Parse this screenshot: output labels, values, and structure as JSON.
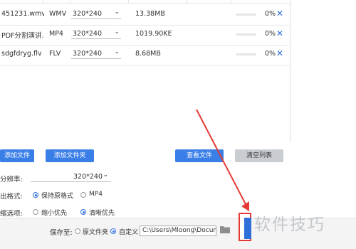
{
  "files": [
    {
      "name": "451231.wmv",
      "format": "WMV",
      "resolution": "320*240",
      "size": "13.38MB",
      "progress_pct": "0%"
    },
    {
      "name": "PDF分割演讲...",
      "format": "MP4",
      "resolution": "320*240",
      "size": "1019.90KE",
      "progress_pct": "0%"
    },
    {
      "name": "sdgfdryg.flv",
      "format": "FLV",
      "resolution": "320*240",
      "size": "8.68MB",
      "progress_pct": "0%"
    }
  ],
  "buttons": {
    "add_file": "添加文件",
    "add_folder": "添加文件夹",
    "view_file": "查看文件",
    "clear_list": "清空列表"
  },
  "settings": {
    "resolution_label": "分辨率:",
    "resolution_value": "320*240",
    "output_format_label": "出格式:",
    "output_format_options": [
      "保持原格式",
      "MP4"
    ],
    "output_format_selected": "保持原格式",
    "compress_label": "缩选项:",
    "compress_options": [
      "缩小优先",
      "清晰优先"
    ],
    "compress_selected": "清晰优先"
  },
  "save": {
    "label": "保存至:",
    "options": [
      "原文件夹",
      "自定义"
    ],
    "selected": "自定义",
    "path": "C:\\Users\\Mloong\\Docume"
  },
  "watermark": "软件技巧",
  "icons": [
    "close-icon",
    "chevron-down-icon",
    "folder-icon",
    "radio-icon"
  ],
  "colors": {
    "accent": "#3a7ee8",
    "annotation": "#e53935",
    "close": "#2e6fe0"
  }
}
